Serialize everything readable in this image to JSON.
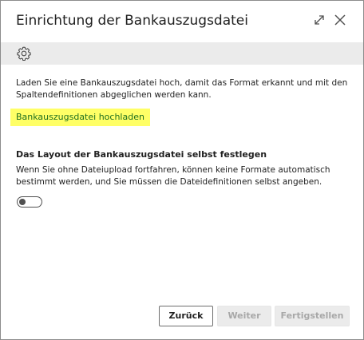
{
  "dialog": {
    "title": "Einrichtung der Bankauszugsdatei"
  },
  "titlebar": {
    "icons": [
      "expand-icon",
      "close-icon"
    ]
  },
  "actionbar": {
    "icons": [
      "gear-icon"
    ]
  },
  "content": {
    "intro_text": "Laden Sie eine Bankauszugsdatei hoch, damit das Format erkannt und mit den Spaltendefinitionen abgeglichen werden kann.",
    "upload_link": "Bankauszugsdatei hochladen",
    "highlight_color": "#ffff66",
    "layout_heading": "Das Layout der Bankauszugsdatei selbst festlegen",
    "layout_description": "Wenn Sie ohne Dateiupload fortfahren, können keine Formate automatisch bestimmt werden, und Sie müssen die Dateidefinitionen selbst angeben.",
    "toggle_on": false
  },
  "footer": {
    "back_label": "Zurück",
    "next_label": "Weiter",
    "finish_label": "Fertigstellen",
    "next_enabled": false,
    "finish_enabled": false
  }
}
